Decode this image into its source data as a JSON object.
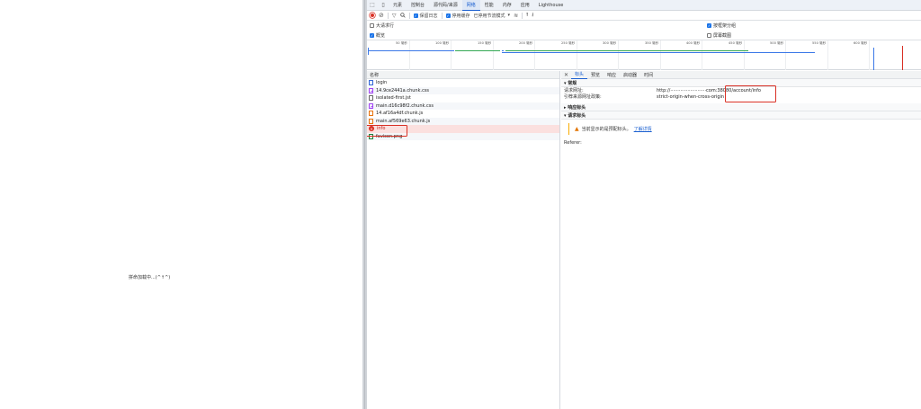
{
  "page": {
    "loading_text": "拼命加载中...(^↑^)"
  },
  "devtools": {
    "main_tabs": [
      {
        "label": "元素"
      },
      {
        "label": "控制台"
      },
      {
        "label": "源代码/来源"
      },
      {
        "label": "网络",
        "active": true
      },
      {
        "label": "性能"
      },
      {
        "label": "内存"
      },
      {
        "label": "应用"
      },
      {
        "label": "Lighthouse"
      }
    ],
    "toolbar": {
      "preserve_log": "保留日志",
      "disable_cache": "停用缓存",
      "throttle": "已停用节流模式",
      "throttle_caret": "▾"
    },
    "filters": {
      "big_rows": "大请求行",
      "group_by_frame": "按框架分组",
      "overview": "概览",
      "screenshots": "屏幕截图"
    },
    "timeline": {
      "ticks": [
        "50 毫秒",
        "100 毫秒",
        "150 毫秒",
        "200 毫秒",
        "250 毫秒",
        "300 毫秒",
        "350 毫秒",
        "400 毫秒",
        "450 毫秒",
        "500 毫秒",
        "550 毫秒",
        "600 毫秒"
      ]
    },
    "requests": {
      "header": "名称",
      "rows": [
        {
          "name": "login",
          "type": "doc"
        },
        {
          "name": "14.9ce2441a.chunk.css",
          "type": "css"
        },
        {
          "name": "isolated-first.jst",
          "type": "plain"
        },
        {
          "name": "main.d16c98f2.chunk.css",
          "type": "css"
        },
        {
          "name": "14.af16a4df.chunk.js",
          "type": "js"
        },
        {
          "name": "main.af569e63.chunk.js",
          "type": "js"
        },
        {
          "name": "info",
          "type": "error"
        },
        {
          "name": "favicon.png",
          "type": "img"
        }
      ]
    },
    "details": {
      "close": "✕",
      "tabs": [
        "标头",
        "预览",
        "响应",
        "启动器",
        "时间"
      ],
      "general": {
        "title": "▾ 常规",
        "request_url_key": "请求网址:",
        "request_url_value": "http://·························com:38080/account/info",
        "referrer_policy_key": "引荐来源网址政策:",
        "referrer_policy_value": "strict-origin-when-cross-origin"
      },
      "response_headers_title": "▸ 响应标头",
      "request_headers": {
        "title": "▾ 请求标头",
        "warning": "当前显示的是预配标头。",
        "learn_more": "了解详情",
        "referer_key": "Referer:"
      }
    }
  }
}
